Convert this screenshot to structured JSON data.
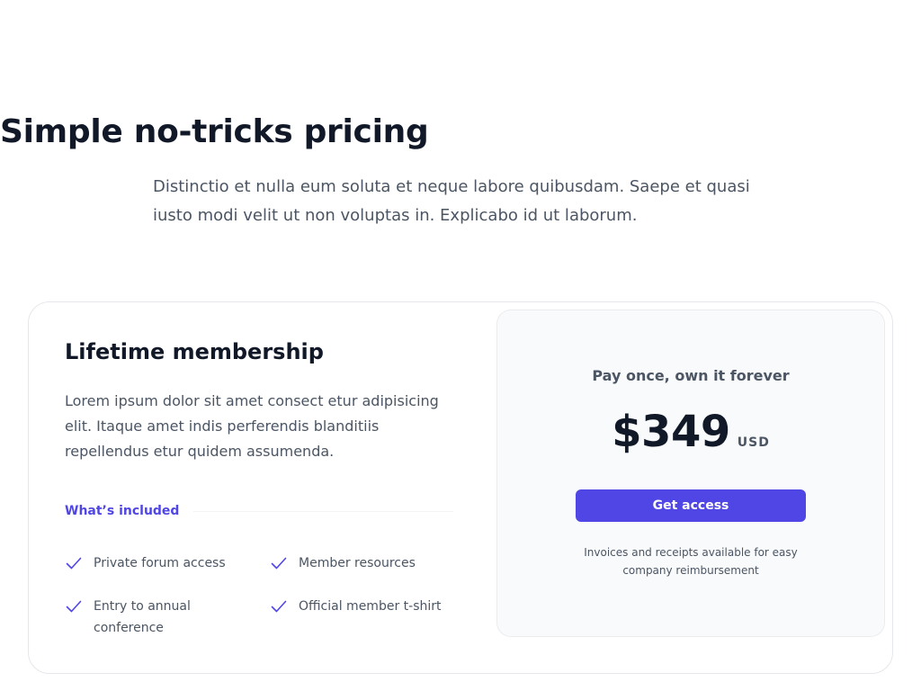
{
  "header": {
    "title": "Simple no-tricks pricing",
    "subtitle": "Distinctio et nulla eum soluta et neque labore quibusdam. Saepe et quasi iusto modi velit ut non voluptas in. Explicabo id ut laborum."
  },
  "plan": {
    "title": "Lifetime membership",
    "description": "Lorem ipsum dolor sit amet consect etur adipisicing elit. Itaque amet indis perferendis blanditiis repellendus etur quidem assumenda.",
    "included_label": "What’s included",
    "features": [
      {
        "label": "Private forum access",
        "icon": "check-icon"
      },
      {
        "label": "Member resources",
        "icon": "check-icon"
      },
      {
        "label": "Entry to annual conference",
        "icon": "check-icon"
      },
      {
        "label": "Official member t-shirt",
        "icon": "check-icon"
      }
    ]
  },
  "purchase": {
    "tagline": "Pay once, own it forever",
    "price": "$349",
    "currency": "USD",
    "cta_label": "Get access",
    "note": "Invoices and receipts available for easy company reimbursement"
  },
  "colors": {
    "accent": "#4f46e5",
    "heading": "#111827",
    "body_text": "#4b5563",
    "panel_bg": "#f9fafb",
    "border": "#e5e7eb"
  }
}
